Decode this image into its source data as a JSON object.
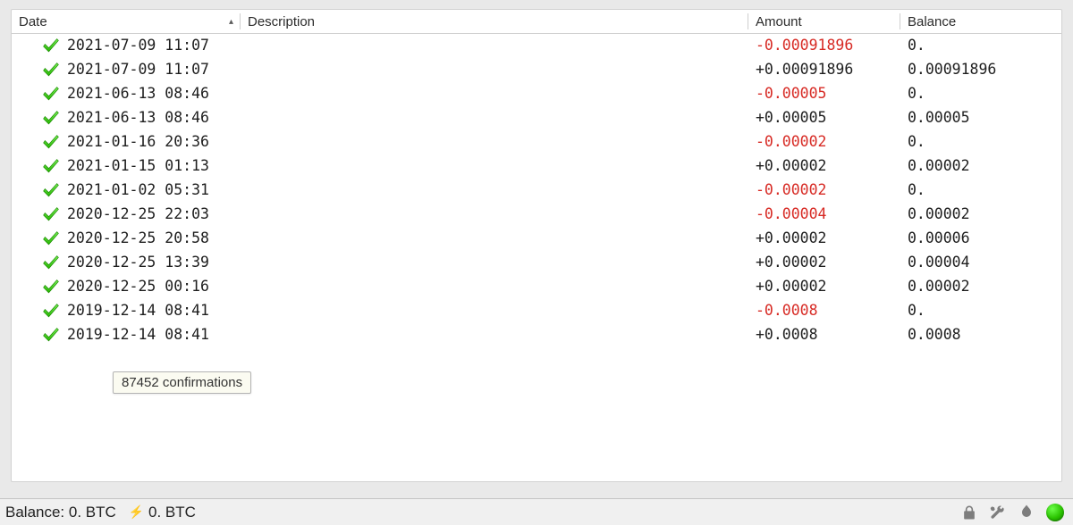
{
  "columns": {
    "date": "Date",
    "description": "Description",
    "amount": "Amount",
    "balance": "Balance"
  },
  "sort_indicator": "▴",
  "transactions": [
    {
      "date": "2021-07-09 11:07",
      "description": "",
      "amount": "-0.00091896",
      "balance": "0.",
      "negative": true
    },
    {
      "date": "2021-07-09 11:07",
      "description": "",
      "amount": "+0.00091896",
      "balance": "0.00091896",
      "negative": false
    },
    {
      "date": "2021-06-13 08:46",
      "description": "",
      "amount": "-0.00005",
      "balance": "0.",
      "negative": true
    },
    {
      "date": "2021-06-13 08:46",
      "description": "",
      "amount": "+0.00005",
      "balance": "0.00005",
      "negative": false
    },
    {
      "date": "2021-01-16 20:36",
      "description": "",
      "amount": "-0.00002",
      "balance": "0.",
      "negative": true
    },
    {
      "date": "2021-01-15 01:13",
      "description": "",
      "amount": "+0.00002",
      "balance": "0.00002",
      "negative": false
    },
    {
      "date": "2021-01-02 05:31",
      "description": "",
      "amount": "-0.00002",
      "balance": "0.",
      "negative": true
    },
    {
      "date": "2020-12-25 22:03",
      "description": "",
      "amount": "-0.00004",
      "balance": "0.00002",
      "negative": true
    },
    {
      "date": "2020-12-25 20:58",
      "description": "",
      "amount": "+0.00002",
      "balance": "0.00006",
      "negative": false
    },
    {
      "date": "2020-12-25 13:39",
      "description": "",
      "amount": "+0.00002",
      "balance": "0.00004",
      "negative": false
    },
    {
      "date": "2020-12-25 00:16",
      "description": "",
      "amount": "+0.00002",
      "balance": "0.00002",
      "negative": false
    },
    {
      "date": "2019-12-14 08:41",
      "description": "",
      "amount": "-0.0008",
      "balance": "0.",
      "negative": true
    },
    {
      "date": "2019-12-14 08:41",
      "description": "",
      "amount": "+0.0008",
      "balance": "0.0008",
      "negative": false
    }
  ],
  "tooltip": "87452 confirmations",
  "status": {
    "balance_label": "Balance:",
    "balance_value": "0. BTC",
    "lightning_value": "0. BTC"
  }
}
